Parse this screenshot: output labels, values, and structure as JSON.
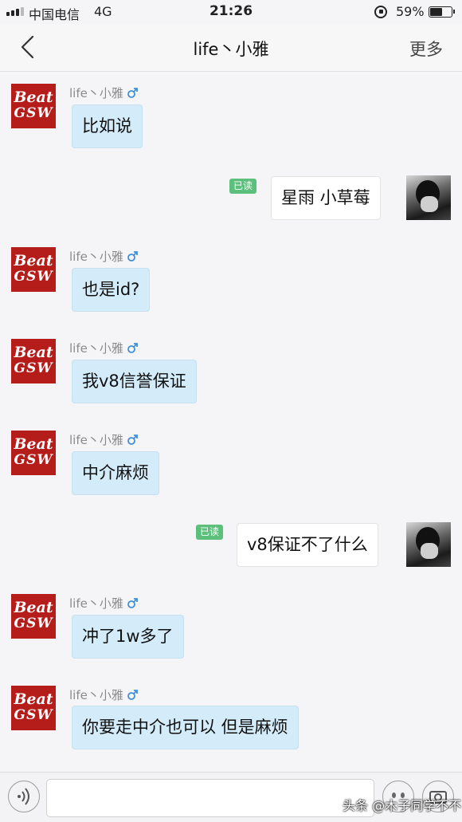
{
  "status_bar": {
    "carrier": "中国电信",
    "network": "4G",
    "time": "21:26",
    "battery_percent": "59%",
    "battery_level": 0.59
  },
  "header": {
    "title": "life丶小雅",
    "more_label": "更多",
    "back_icon": "chevron-left-icon"
  },
  "contact": {
    "name": "life丶小雅",
    "gender_icon": "male-icon",
    "avatar_text": [
      "Beat",
      "GSW"
    ],
    "avatar_color": "#b51d1b"
  },
  "read_label": "已读",
  "messages": [
    {
      "direction": "in",
      "text": "比如说"
    },
    {
      "direction": "out",
      "text": "星雨 小草莓",
      "read": true
    },
    {
      "direction": "in",
      "text": "也是id?"
    },
    {
      "direction": "in",
      "text": "我v8信誉保证"
    },
    {
      "direction": "in",
      "text": "中介麻烦"
    },
    {
      "direction": "out",
      "text": "v8保证不了什么",
      "read": true
    },
    {
      "direction": "in",
      "text": "冲了1w多了"
    },
    {
      "direction": "in",
      "text": "你要走中介也可以 但是麻烦"
    }
  ],
  "input_bar": {
    "voice_icon": "voice-icon",
    "emoji_icon": "emoji-icon",
    "camera_icon": "camera-icon"
  },
  "watermark": "头条 @木子同学不不",
  "colors": {
    "incoming_bubble": "#d4ecfa",
    "outgoing_bubble": "#ffffff",
    "read_badge": "#5cbf7b"
  }
}
